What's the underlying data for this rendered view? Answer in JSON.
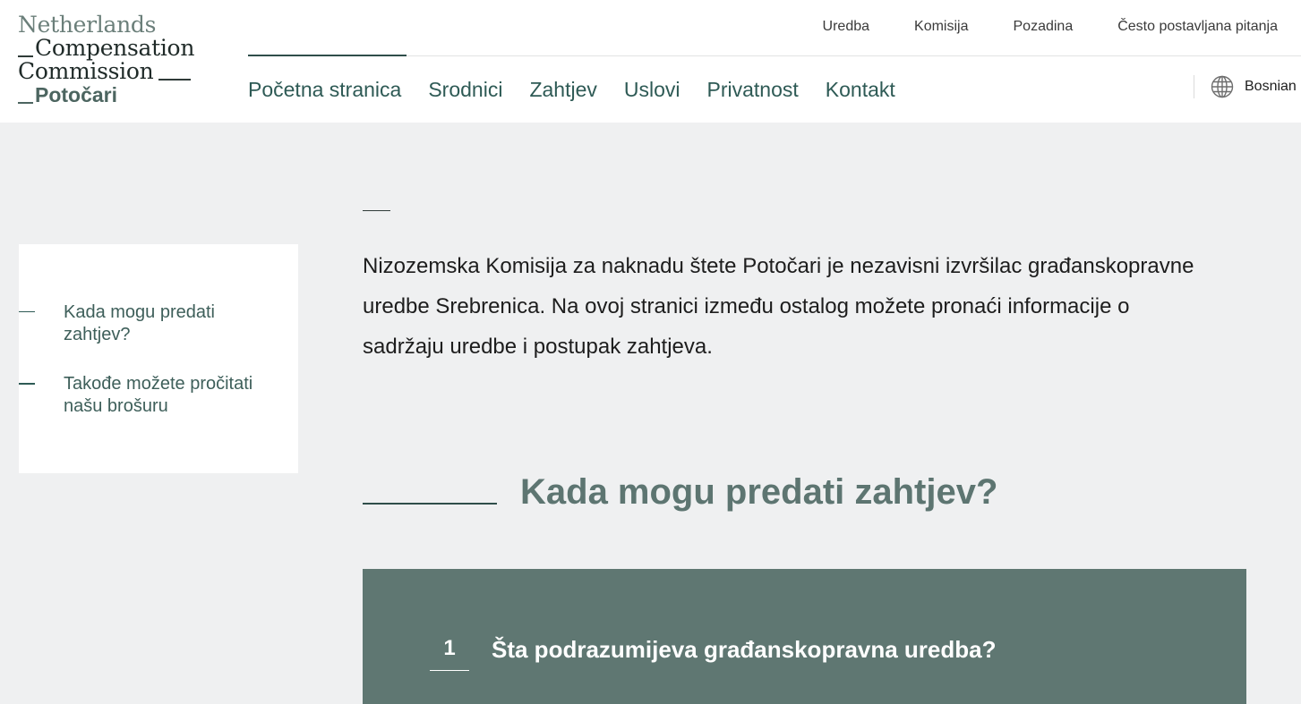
{
  "logo": {
    "line1": "Netherlands",
    "line2": "Compensation",
    "line3": "Commission",
    "line4": "Potočari"
  },
  "top_nav": [
    "Uredba",
    "Komisija",
    "Pozadina",
    "Često postavljana pitanja"
  ],
  "main_nav": [
    {
      "label": "Početna stranica",
      "active": true
    },
    {
      "label": "Srodnici"
    },
    {
      "label": "Zahtjev"
    },
    {
      "label": "Uslovi"
    },
    {
      "label": "Privatnost"
    },
    {
      "label": "Kontakt"
    }
  ],
  "language": {
    "icon": "globe-icon",
    "label": "Bosnian"
  },
  "sidebar": {
    "items": [
      {
        "label": "Kada mogu predati zahtjev?"
      },
      {
        "label": "Takođe možete pročitati našu brošuru"
      }
    ]
  },
  "intro": "Nizozemska Komisija za naknadu štete Potočari je nezavisni izvršilac građanskopravne uredbe Srebrenica. Na ovoj stranici između ostalog možete pronaći informacije o sadržaju uredbe i postupak zahtjeva.",
  "section": {
    "title": "Kada mogu predati zahtjev?"
  },
  "faq": [
    {
      "number": "1",
      "question": "Šta podrazumijeva građanskopravna uredba?"
    }
  ],
  "colors": {
    "accent": "#2e5a55",
    "panel": "#5f7772",
    "background": "#eff0f1"
  }
}
